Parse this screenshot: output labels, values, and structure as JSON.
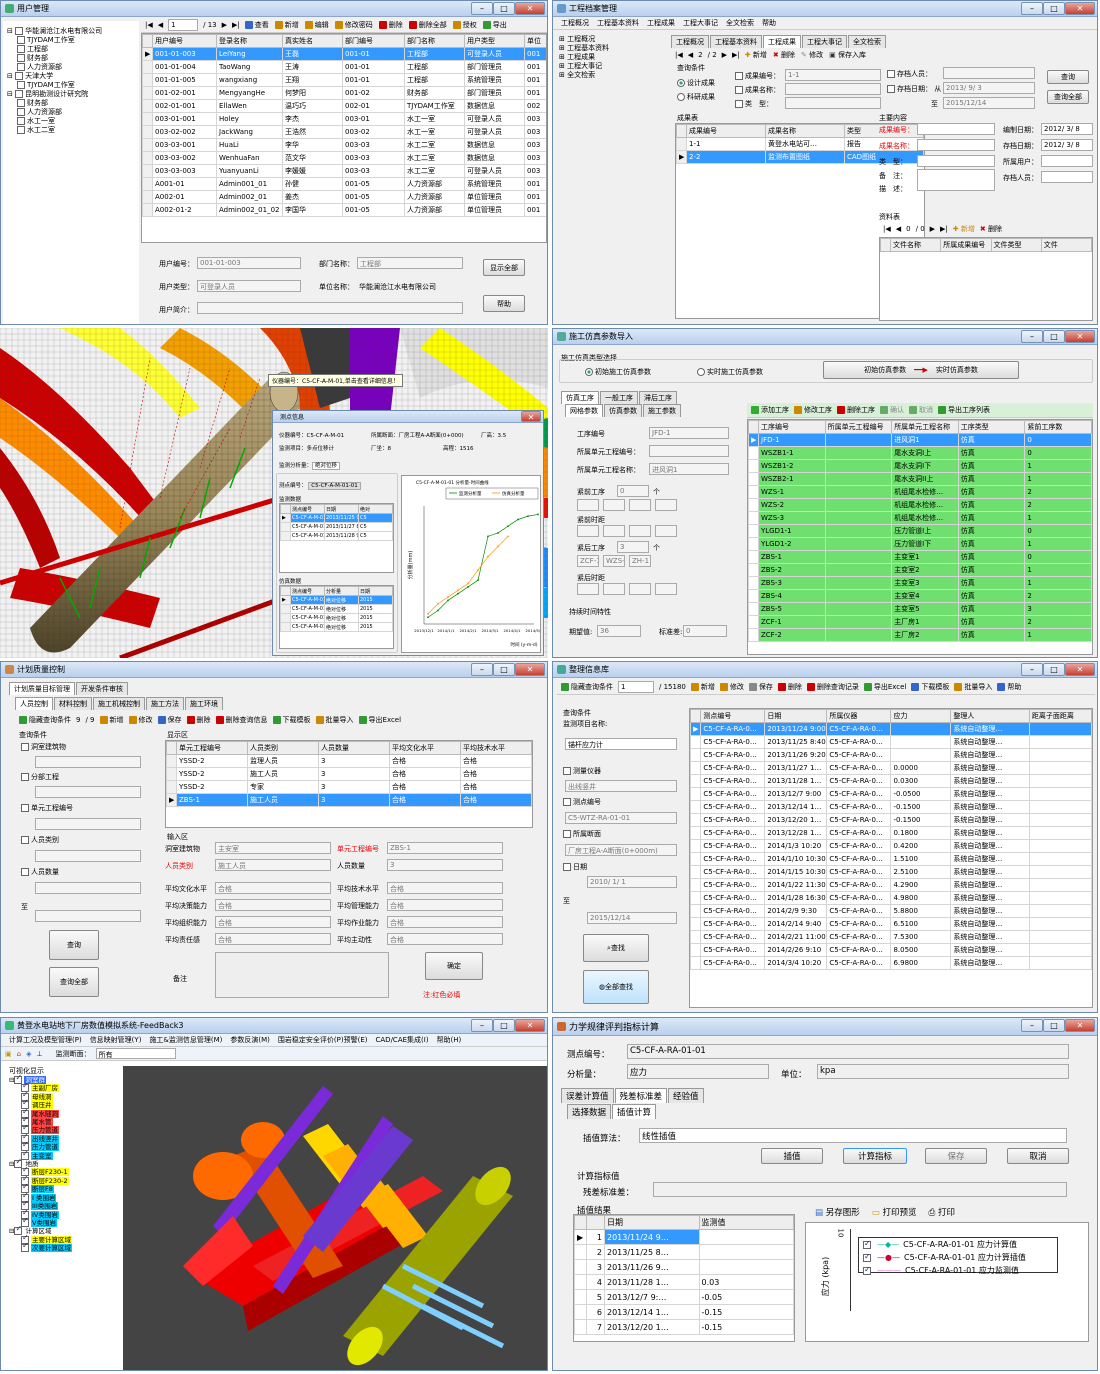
{
  "w1": {
    "title": "用户管理",
    "tree": [
      "华能澜沧江水电有限公司",
      "TJYDAM工作室",
      "工程部",
      "财务部",
      "人力资源部",
      "天津大学",
      "TJYDAM工作室",
      "昆明勘测设计研究院",
      "财务部",
      "人力资源部",
      "水工一室",
      "水工二室"
    ],
    "page": "1",
    "total": "/ 13",
    "tools": [
      "查看",
      "新增",
      "编辑",
      "修改密码",
      "删除",
      "删除全部",
      "授权",
      "导出"
    ],
    "cols": [
      "用户编号",
      "登录名称",
      "真实姓名",
      "部门编号",
      "部门名称",
      "用户类型",
      "单位"
    ],
    "rows": [
      [
        "001-01-003",
        "LeiYang",
        "王磊",
        "001-01",
        "工程部",
        "可登录人员",
        "001"
      ],
      [
        "001-01-004",
        "TaoWang",
        "王涛",
        "001-01",
        "工程部",
        "部门管理员",
        "001"
      ],
      [
        "001-01-005",
        "wangxiang",
        "王翔",
        "001-01",
        "工程部",
        "系统管理员",
        "001"
      ],
      [
        "001-02-001",
        "MengyangHe",
        "何梦阳",
        "001-02",
        "财务部",
        "部门管理员",
        "001"
      ],
      [
        "002-01-001",
        "EllaWen",
        "温巧巧",
        "002-01",
        "TJYDAM工作室",
        "数据信息",
        "002"
      ],
      [
        "003-01-001",
        "Holey",
        "李杰",
        "003-01",
        "水工一室",
        "可登录人员",
        "003"
      ],
      [
        "003-02-002",
        "JackWang",
        "王浩然",
        "003-02",
        "水工一室",
        "可登录人员",
        "003"
      ],
      [
        "003-03-001",
        "HuaLi",
        "李华",
        "003-03",
        "水工二室",
        "数据信息",
        "003"
      ],
      [
        "003-03-002",
        "WenhuaFan",
        "范文华",
        "003-03",
        "水工二室",
        "数据信息",
        "003"
      ],
      [
        "003-03-003",
        "YuanyuanLi",
        "李媛媛",
        "003-03",
        "水工二室",
        "可登录人员",
        "003"
      ],
      [
        "A001-01",
        "Admin001_01",
        "孙健",
        "001-05",
        "人力资源部",
        "系统管理员",
        "001"
      ],
      [
        "A002-01",
        "Admin002_01",
        "姜杰",
        "001-05",
        "人力资源部",
        "单位管理员",
        "001"
      ],
      [
        "A002-01-2",
        "Admin002_01_02",
        "李国华",
        "001-05",
        "人力资源部",
        "单位管理员",
        "001"
      ]
    ],
    "f_uid": "用户编号：",
    "v_uid": "001-01-003",
    "f_dept": "部门名称：",
    "v_dept": "工程部",
    "f_type": "用户类型：",
    "v_type": "可登录人员",
    "f_unit": "单位名称：",
    "v_unit": "华能澜沧江水电有限公司",
    "f_desc": "用户简介：",
    "b_all": "显示全部",
    "b_help": "帮助"
  },
  "w2": {
    "title": "工程档案管理",
    "menu": [
      "工程概况",
      "工程基本资料",
      "工程成果",
      "工程大事记",
      "全文检索",
      "帮助"
    ],
    "tree": [
      "工程概况",
      "工程基本资料",
      "工程成果",
      "工程大事记",
      "全文检索"
    ],
    "tabs": [
      "工程概况",
      "工程基本资料",
      "工程成果",
      "工程大事记",
      "全文检索"
    ],
    "page": "2",
    "total": "/ 2",
    "tools": [
      "新增",
      "删除",
      "修改",
      "保存入库"
    ],
    "q": "查询条件",
    "r1": "设计成果",
    "r2": "科研成果",
    "c1": "成果编号：",
    "v1": "1-1",
    "c2": "成果名称：",
    "c3": "类　型：",
    "c4": "存档人员：",
    "c5": "存档日期：",
    "from": "从",
    "d1": "2013/ 9/ 3",
    "to": "至",
    "d2": "2015/12/14",
    "b_q": "查询",
    "b_all": "查询全部",
    "tbl": "成果表",
    "cols": [
      "成果编号",
      "成果名称",
      "类型"
    ],
    "rows": [
      [
        "1-1",
        "黄登水电站可…",
        "报告"
      ],
      [
        "2-2",
        "监测布置图纸",
        "CAD图纸"
      ]
    ],
    "main": "主要内容",
    "m1": "成果编号：",
    "m2": "成果名称：",
    "m3": "类　型：",
    "m4": "备　注：",
    "m5": "描　述：",
    "m6": "编制日期：",
    "m6v": "2012/ 3/ 8",
    "m7": "存档日期：",
    "m7v": "2012/ 3/ 8",
    "m8": "所属用户：",
    "m9": "存档人员：",
    "files": "资料表",
    "fpage": "0",
    "ftotal": "/ 0",
    "ftools": [
      "新增",
      "删除"
    ],
    "fcols": [
      "文件名称",
      "所属成果编号",
      "文件类型",
      "文件"
    ]
  },
  "w3": {
    "tip": "仪器编号：C5-CF-A-M-01,单击查看详细信息！",
    "dlg": "测点信息",
    "f1": "仪器编号：",
    "v1": "C5-CF-A-M-01",
    "f2": "所属断面：",
    "v2": "厂房工程A-A断面(0+000)",
    "f3": "厂高：",
    "v3": "3.5",
    "f4": "监测项目：",
    "v4": "多点位移计",
    "f5": "厂坐：",
    "v5": "8",
    "f6": "高程：",
    "v6": "1516",
    "f7": "监测分析量：",
    "v7": "绝对位移",
    "f8": "测点编号：",
    "v8": "C5-CF-A-M-01-01",
    "g1": "监测数据",
    "g1cols": [
      "测点编号",
      "日期",
      "绝对"
    ],
    "g1rows": [
      [
        "C5-CF-A-M-01-01",
        "2013/11/25 9:00",
        "C5"
      ],
      [
        "C5-CF-A-M-01-01",
        "2013/11/27 8:10",
        "C5"
      ],
      [
        "C5-CF-A-M-01-01",
        "2013/11/28 9:00",
        "C5"
      ]
    ],
    "g2": "仿真数据",
    "g2cols": [
      "测点编号",
      "分析量",
      "日期"
    ],
    "g2rows": [
      [
        "C5-CF-A-M-01-01",
        "绝对位移",
        "2015"
      ],
      [
        "C5-CF-A-M-01-01",
        "绝对位移",
        "2015"
      ],
      [
        "C5-CF-A-M-01-01",
        "绝对位移",
        "2015"
      ],
      [
        "C5-CF-A-M-01-01",
        "绝对位移",
        "2015"
      ]
    ],
    "ctitle": "C5-CF-A-M-01-01 分析量-时间曲线",
    "leg1": "监测分析量",
    "leg2": "仿真分析量",
    "ylab": "分析量(mm)",
    "xlab": "时间 (y-m-d)"
  },
  "w4": {
    "title": "施工仿真参数导入",
    "sel": "施工仿真类型选择",
    "r1": "初始施工仿真参数",
    "r2": "实时施工仿真参数",
    "b1": "初始仿真参数",
    "b2": "实时仿真参数",
    "tabs": [
      "仿真工序",
      "一般工序",
      "滞后工序"
    ],
    "sub": [
      "网格参数",
      "仿真参数",
      "施工参数"
    ],
    "f1": "工序编号",
    "v1": "JFD-1",
    "f2": "所属单元工程编号：",
    "f3": "所属单元工程名称：",
    "v3": "进风洞1",
    "f4": "紧前工序",
    "v4": "0",
    "ge": "个",
    "f5": "紧前时距",
    "f6": "紧后工序",
    "v6": "3",
    "l1": "ZCF-1",
    "l2": "WZS-2",
    "l3": "ZH-1",
    "f7": "紧后时距",
    "dur": "持续时间特性",
    "f8": "期望值:",
    "v8": "36",
    "f9": "标准差:",
    "v9": "0",
    "tools": [
      "添加工序",
      "修改工序",
      "删除工序",
      "确认",
      "取消",
      "导出工序列表"
    ],
    "cols": [
      "工序编号",
      "所属单元工程编号",
      "所属单元工程名称",
      "工序类型",
      "紧前工序数"
    ],
    "rows": [
      [
        "JFD-1",
        "进风洞1",
        "仿真",
        "0"
      ],
      [
        "WSZB1-1",
        "尾水支洞I上",
        "仿真",
        "0"
      ],
      [
        "WSZB1-2",
        "尾水支洞I下",
        "仿真",
        "1"
      ],
      [
        "WSZB2-1",
        "尾水支洞II上",
        "仿真",
        "1"
      ],
      [
        "WZS-1",
        "机组尾水检修…",
        "仿真",
        "2"
      ],
      [
        "WZS-2",
        "机组尾水检修…",
        "仿真",
        "2"
      ],
      [
        "WZS-3",
        "机组尾水检修…",
        "仿真",
        "1"
      ],
      [
        "YLGD1-1",
        "压力管道I上",
        "仿真",
        "0"
      ],
      [
        "YLGD1-2",
        "压力管道I下",
        "仿真",
        "1"
      ],
      [
        "ZBS-1",
        "主变室1",
        "仿真",
        "0"
      ],
      [
        "ZBS-2",
        "主变室2",
        "仿真",
        "1"
      ],
      [
        "ZBS-3",
        "主变室3",
        "仿真",
        "1"
      ],
      [
        "ZBS-4",
        "主变室4",
        "仿真",
        "2"
      ],
      [
        "ZBS-5",
        "主变室5",
        "仿真",
        "3"
      ],
      [
        "ZCF-1",
        "主厂房1",
        "仿真",
        "2"
      ],
      [
        "ZCF-2",
        "主厂房2",
        "仿真",
        "1"
      ]
    ]
  },
  "w5": {
    "title": "计划质量控制",
    "tabs": [
      "计划质量目标管理",
      "开发条件审核"
    ],
    "sub": [
      "人员控制",
      "材料控制",
      "施工机械控制",
      "施工方法",
      "施工环境"
    ],
    "tools": [
      "隐藏查询条件",
      "新增",
      "修改",
      "保存",
      "删除",
      "删除查询信息",
      "下载模板",
      "批量导入",
      "导出Excel"
    ],
    "page": "9",
    "total": "/ 9",
    "qc": "查询条件",
    "c1": "洞室建筑物",
    "c2": "分部工程",
    "c3": "单元工程编号",
    "c4": "人员类别",
    "c5": "人员数量",
    "zhi": "至",
    "bq": "查询",
    "ball": "查询全部",
    "disp": "显示区",
    "cols": [
      "单元工程编号",
      "人员类别",
      "人员数量",
      "平均文化水平",
      "平均技术水平"
    ],
    "rows": [
      [
        "YSSD-2",
        "监理人员",
        "3",
        "合格",
        "合格"
      ],
      [
        "YSSD-2",
        "施工人员",
        "3",
        "合格",
        "合格"
      ],
      [
        "YSSD-2",
        "专家",
        "3",
        "合格",
        "合格"
      ],
      [
        "ZBS-1",
        "施工人员",
        "3",
        "合格",
        "合格"
      ]
    ],
    "inp": "输入区",
    "i1": "洞室建筑物",
    "i1v": "主安室",
    "i2": "单元工程编号",
    "i2v": "ZBS-1",
    "i3": "人员类别",
    "i3v": "施工人员",
    "i4": "人员数量",
    "i4v": "3",
    "i5": "平均文化水平",
    "i6": "平均技术水平",
    "i7": "平均决策能力",
    "i8": "平均管理能力",
    "i9": "平均组织能力",
    "i10": "平均作业能力",
    "i11": "平均责任感",
    "i12": "平均主动性",
    "ok": "合格",
    "rem": "备注",
    "confirm": "确定",
    "note": "注:红色必填"
  },
  "w6": {
    "title": "整理信息库",
    "tools": [
      "隐藏查询条件",
      "新增",
      "修改",
      "保存",
      "删除",
      "删除查询记录",
      "导出Excel",
      "下载模板",
      "批量导入",
      "帮助"
    ],
    "page": "1",
    "total": "/ 15180",
    "qc": "查询条件",
    "c1": "监测项目名称:",
    "c1v": "锚杆应力计",
    "c2": "测量仪器",
    "c2v": "出线竖井",
    "c3": "测点编号",
    "c3v": "C5-WTZ-RA-01-01",
    "c4": "所属断面",
    "c4v": "厂房工程A-A断面(0+000m)",
    "c5": "日期",
    "d1": "2010/ 1/ 1",
    "zhi": "至",
    "d2": "2015/12/14",
    "bq": "查找",
    "ball": "全部查找",
    "cols": [
      "测点编号",
      "日期",
      "所属仪器",
      "应力",
      "整理人",
      "距离子面距离"
    ],
    "rows": [
      [
        "C5-CF-A-RA-0…",
        "2013/11/24 9:00",
        "C5-CF-A-RA-0…",
        "",
        "系统自动整理…"
      ],
      [
        "C5-CF-A-RA-0…",
        "2013/11/25 8:40",
        "C5-CF-A-RA-0…",
        "",
        "系统自动整理…"
      ],
      [
        "C5-CF-A-RA-0…",
        "2013/11/26 9:20",
        "C5-CF-A-RA-0…",
        "",
        "系统自动整理…"
      ],
      [
        "C5-CF-A-RA-0…",
        "2013/11/27 1…",
        "C5-CF-A-RA-0…",
        "0.0000",
        "系统自动整理…"
      ],
      [
        "C5-CF-A-RA-0…",
        "2013/11/28 1…",
        "C5-CF-A-RA-0…",
        "0.0300",
        "系统自动整理…"
      ],
      [
        "C5-CF-A-RA-0…",
        "2013/12/7 9:00",
        "C5-CF-A-RA-0…",
        "-0.0500",
        "系统自动整理…"
      ],
      [
        "C5-CF-A-RA-0…",
        "2013/12/14 1…",
        "C5-CF-A-RA-0…",
        "-0.1500",
        "系统自动整理…"
      ],
      [
        "C5-CF-A-RA-0…",
        "2013/12/20 1…",
        "C5-CF-A-RA-0…",
        "-0.1500",
        "系统自动整理…"
      ],
      [
        "C5-CF-A-RA-0…",
        "2013/12/28 1…",
        "C5-CF-A-RA-0…",
        "0.1800",
        "系统自动整理…"
      ],
      [
        "C5-CF-A-RA-0…",
        "2014/1/3 10:20",
        "C5-CF-A-RA-0…",
        "0.4200",
        "系统自动整理…"
      ],
      [
        "C5-CF-A-RA-0…",
        "2014/1/10 10:30",
        "C5-CF-A-RA-0…",
        "1.5100",
        "系统自动整理…"
      ],
      [
        "C5-CF-A-RA-0…",
        "2014/1/15 10:30",
        "C5-CF-A-RA-0…",
        "2.5100",
        "系统自动整理…"
      ],
      [
        "C5-CF-A-RA-0…",
        "2014/1/22 11:30",
        "C5-CF-A-RA-0…",
        "4.2900",
        "系统自动整理…"
      ],
      [
        "C5-CF-A-RA-0…",
        "2014/1/28 16:30",
        "C5-CF-A-RA-0…",
        "4.9800",
        "系统自动整理…"
      ],
      [
        "C5-CF-A-RA-0…",
        "2014/2/9 9:30",
        "C5-CF-A-RA-0…",
        "5.8800",
        "系统自动整理…"
      ],
      [
        "C5-CF-A-RA-0…",
        "2014/2/14 9:40",
        "C5-CF-A-RA-0…",
        "6.5100",
        "系统自动整理…"
      ],
      [
        "C5-CF-A-RA-0…",
        "2014/2/21 11:00",
        "C5-CF-A-RA-0…",
        "7.5300",
        "系统自动整理…"
      ],
      [
        "C5-CF-A-RA-0…",
        "2014/2/26 9:10",
        "C5-CF-A-RA-0…",
        "8.0500",
        "系统自动整理…"
      ],
      [
        "C5-CF-A-RA-0…",
        "2014/3/4 10:20",
        "C5-CF-A-RA-0…",
        "6.9800",
        "系统自动整理…"
      ]
    ]
  },
  "w7": {
    "title": "黄登水电站地下厂房数值模拟系统-FeedBack3",
    "menu": [
      "计算工况及模型管理(P)",
      "信息映射管理(Y)",
      "施工&监测信息管理(M)",
      "参数反演(M)",
      "围岩稳定安全评价(P)预警(E)",
      "CAD/CAE集成(I)",
      "帮助(H)"
    ],
    "mon": "监测断面：",
    "monv": "所有",
    "vis": "可视化显示",
    "tree": [
      [
        "洞室群",
        "#fff"
      ],
      [
        "主副厂房",
        "#ff0"
      ],
      [
        "母线洞",
        "#ff0"
      ],
      [
        "调压井",
        "#ff0"
      ],
      [
        "尾水隧洞",
        "#f44"
      ],
      [
        "尾水管",
        "#f44"
      ],
      [
        "压力管道",
        "#f44"
      ],
      [
        "出线竖井",
        "#0cf"
      ],
      [
        "压力管道",
        "#0cf"
      ],
      [
        "主变室",
        "#0cf"
      ],
      [
        "地质",
        "#fff"
      ],
      [
        "断层F230-1",
        "#ff0"
      ],
      [
        "断层F230-2",
        "#ff0"
      ],
      [
        "断层F8",
        "#0cf"
      ],
      [
        "I 类围岩",
        "#0cf"
      ],
      [
        "III类围岩",
        "#0cf"
      ],
      [
        "IV类围岩",
        "#0cf"
      ],
      [
        "V类围岩",
        "#0cf"
      ],
      [
        "计算区域",
        "#fff"
      ],
      [
        "主要计算区域",
        "#ff0"
      ],
      [
        "次要计算区域",
        "#0cf"
      ]
    ]
  },
  "w8": {
    "title": "力学规律评判指标计算",
    "f1": "测点编号：",
    "v1": "C5-CF-A-RA-01-01",
    "f2": "分析量：",
    "v2": "应力",
    "f3": "单位：",
    "v3": "kpa",
    "tabs": [
      "误差计算值",
      "残差标准差",
      "经验值"
    ],
    "sub": [
      "选择数据",
      "插值计算"
    ],
    "alg": "插值算法：",
    "algv": "线性插值",
    "b1": "插值",
    "b2": "计算指标",
    "b3": "保存",
    "b4": "取消",
    "ind": "计算指标值",
    "res": "残差标准差：",
    "ir": "插值结果",
    "cols": [
      "日期",
      "监测值"
    ],
    "rows": [
      [
        "1",
        "2013/11/24 9…",
        ""
      ],
      [
        "2",
        "2013/11/25 8…",
        ""
      ],
      [
        "3",
        "2013/11/26 9…",
        ""
      ],
      [
        "4",
        "2013/11/28 1…",
        "0.03"
      ],
      [
        "5",
        "2013/12/7 9:…",
        "-0.05"
      ],
      [
        "6",
        "2013/12/14 1…",
        "-0.15"
      ],
      [
        "7",
        "2013/12/20 1…",
        "-0.15"
      ]
    ],
    "ctools": [
      "另存图形",
      "打印预览",
      "打印"
    ],
    "ylab": "应力 (kpa)",
    "leg": [
      "C5-CF-A-RA-01-01 应力计算值",
      "C5-CF-A-RA-01-01 应力计算插值",
      "C5-CF-A-RA-01-01 应力监测值"
    ],
    "ytick": "10"
  },
  "chart_data": {
    "type": "line",
    "title": "C5-CF-A-M-01-01 分析量-时间曲线",
    "xlabel": "时间 (y-m-d)",
    "ylabel": "分析量(mm)",
    "ylim": [
      0,
      35
    ],
    "x": [
      "2013/12/1",
      "2014/1/1",
      "2014/2/1",
      "2014/3/1",
      "2014/4/1",
      "2014/5/1"
    ],
    "series": [
      {
        "name": "监测分析量",
        "values": [
          2,
          4,
          7,
          9,
          11,
          13,
          26,
          27,
          29,
          31,
          32,
          32.5
        ]
      },
      {
        "name": "仿真分析量",
        "values": [
          3,
          6,
          8,
          10,
          12,
          16,
          20,
          23,
          26
        ]
      }
    ]
  }
}
